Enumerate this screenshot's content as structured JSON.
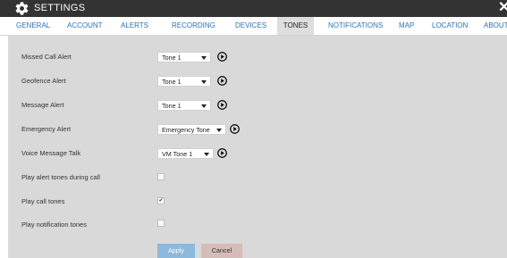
{
  "window": {
    "title": "SETTINGS",
    "close_glyph": "✕"
  },
  "tabs": [
    {
      "label": "GENERAL"
    },
    {
      "label": "ACCOUNT"
    },
    {
      "label": "ALERTS"
    },
    {
      "label": "RECORDING"
    },
    {
      "label": "DEVICES"
    },
    {
      "label": "TONES",
      "active": true
    },
    {
      "label": "NOTIFICATIONS"
    },
    {
      "label": "MAP"
    },
    {
      "label": "LOCATION"
    },
    {
      "label": "ABOUT"
    }
  ],
  "tones": {
    "missed_call": {
      "label": "Missed Call Alert",
      "value": "Tone 1"
    },
    "geofence": {
      "label": "Geofence Alert",
      "value": "Tone 1"
    },
    "message": {
      "label": "Message Alert",
      "value": "Tone 1"
    },
    "emergency": {
      "label": "Emergency Alert",
      "value": "Emergency Tone"
    },
    "voice_message": {
      "label": "Voice Message Talk",
      "value": "VM Tone 1"
    }
  },
  "toggles": {
    "alert_during_call": {
      "label": "Play alert tones during call",
      "checked": false
    },
    "call_tones": {
      "label": "Play call tones",
      "checked": true,
      "mark": "✔"
    },
    "notification_tones": {
      "label": "Play notification tones",
      "checked": false
    }
  },
  "actions": {
    "apply_label": "Apply",
    "cancel_label": "Cancel"
  },
  "icons": {
    "settings": "gear-icon",
    "play": "play-circle-icon",
    "dropdown": "triangle-down-icon",
    "close": "close-icon"
  },
  "colors": {
    "titlebar": "#333333",
    "tab_text": "#2b73b8",
    "active_tab_bg": "#dedede",
    "content_bg": "#d9d9d9",
    "apply_bg": "#8cb9dc",
    "cancel_bg": "#d6bcb8"
  }
}
